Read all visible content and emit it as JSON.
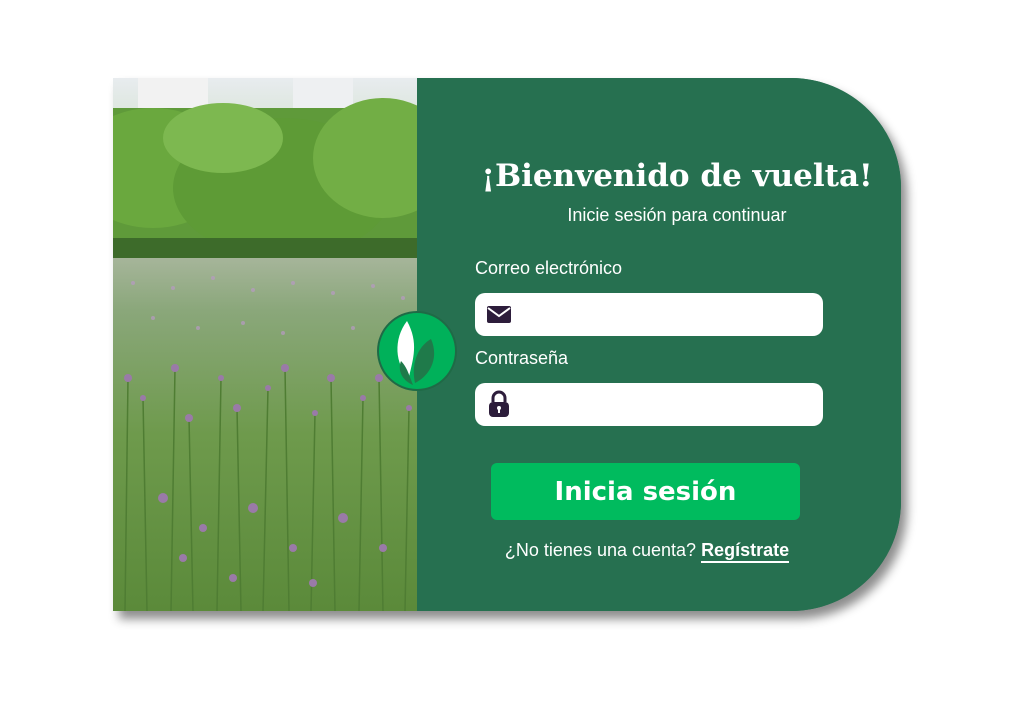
{
  "login": {
    "title": "¡Bienvenido de vuelta!",
    "subtitle": "Inicie sesión para continuar",
    "email_label": "Correo electrónico",
    "email_value": "",
    "password_label": "Contraseña",
    "password_value": "",
    "submit_label": "Inicia sesión",
    "signup_prompt": "¿No tienes una cuenta?",
    "signup_link": "Regístrate"
  },
  "colors": {
    "panel": "#267050",
    "button": "#00bb5e",
    "logo": "#00b15a",
    "icon": "#2d1d3b"
  },
  "icons": {
    "email": "envelope-icon",
    "password": "lock-icon",
    "logo": "leaf-logo-icon"
  }
}
